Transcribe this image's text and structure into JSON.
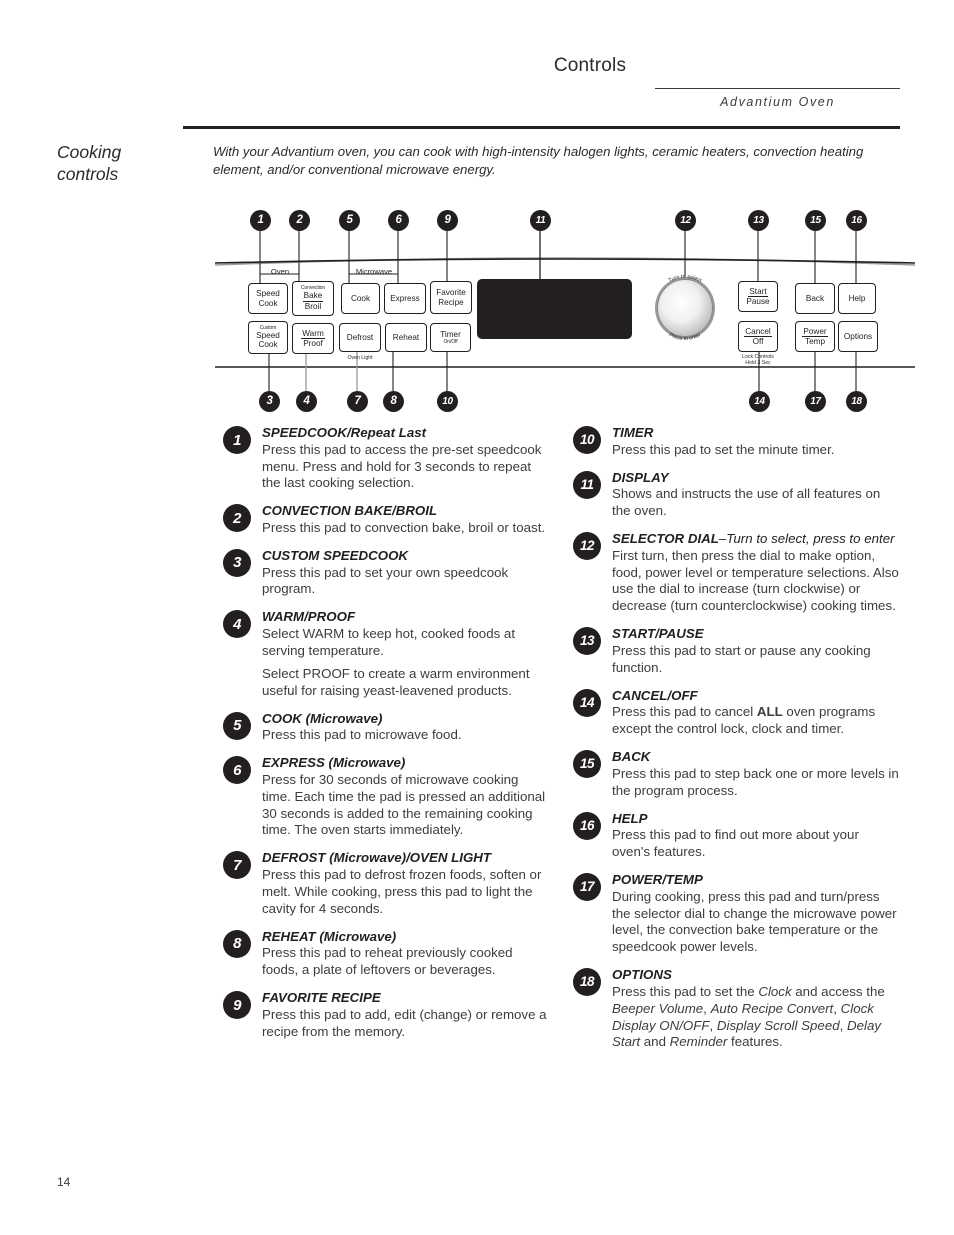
{
  "header": {
    "title": "Controls",
    "subtitle": "Advantium Oven"
  },
  "side_heading": "Cooking\ncontrols",
  "intro": "With your Advantium oven, you can cook with high-intensity halogen lights, ceramic heaters, convection heating element, and/or conventional microwave energy.",
  "page_number": "14",
  "control_panel": {
    "group_labels": {
      "oven": "Oven",
      "microwave": "Microwave"
    },
    "pads": [
      {
        "id": "speed-cook",
        "top": "",
        "lines": [
          "Speed",
          "Cook"
        ]
      },
      {
        "id": "convection-bake-broil",
        "top": "Convection",
        "lines": [
          "Bake",
          "Broil"
        ]
      },
      {
        "id": "custom-speed-cook",
        "top": "Custom",
        "lines": [
          "Speed",
          "Cook"
        ]
      },
      {
        "id": "warm-proof",
        "top": "",
        "lines": [
          "Warm",
          "Proof"
        ]
      },
      {
        "id": "cook",
        "top": "",
        "lines": [
          "Cook"
        ]
      },
      {
        "id": "express",
        "top": "",
        "lines": [
          "Express"
        ]
      },
      {
        "id": "defrost",
        "top": "",
        "lines": [
          "Defrost"
        ]
      },
      {
        "id": "reheat",
        "top": "",
        "lines": [
          "Reheat"
        ]
      },
      {
        "id": "favorite-recipe",
        "top": "",
        "lines": [
          "Favorite",
          "Recipe"
        ]
      },
      {
        "id": "timer-on-off",
        "top": "",
        "lines": [
          "Timer",
          "On/Off"
        ]
      },
      {
        "id": "start-pause",
        "top": "",
        "lines": [
          "Start",
          "Pause"
        ]
      },
      {
        "id": "cancel-off",
        "top": "",
        "lines": [
          "Cancel",
          "Off"
        ]
      },
      {
        "id": "back",
        "top": "",
        "lines": [
          "Back"
        ]
      },
      {
        "id": "help",
        "top": "",
        "lines": [
          "Help"
        ]
      },
      {
        "id": "power-temp",
        "top": "",
        "lines": [
          "Power",
          "Temp"
        ]
      },
      {
        "id": "options",
        "top": "",
        "lines": [
          "Options"
        ]
      }
    ],
    "pad_text": {
      "speed_cook_1": "Speed",
      "speed_cook_2": "Cook",
      "convection": "Convection",
      "bake": "Bake",
      "broil": "Broil",
      "custom": "Custom",
      "custom_speed": "Speed",
      "custom_cook": "Cook",
      "warm": "Warm",
      "proof": "Proof",
      "cook": "Cook",
      "express": "Express",
      "defrost": "Defrost",
      "reheat": "Reheat",
      "favorite": "Favorite",
      "recipe": "Recipe",
      "timer": "Timer",
      "timer_onoff": "On/Off",
      "start": "Start",
      "pause": "Pause",
      "cancel": "Cancel",
      "off": "Off",
      "back": "Back",
      "help": "Help",
      "power": "Power",
      "temp": "Temp",
      "options": "Options"
    },
    "sub_labels": {
      "oven_light": "Oven Light",
      "lock_controls": "Lock Controls",
      "hold_3_sec": "Hold 3 Sec"
    },
    "dial": {
      "turn_to_select": "Turn to select",
      "press_to_enter": "Press to enter"
    },
    "callouts_top": [
      "1",
      "2",
      "5",
      "6",
      "9",
      "11",
      "12",
      "13",
      "15",
      "16"
    ],
    "callouts_bottom": [
      "3",
      "4",
      "7",
      "8",
      "10",
      "14",
      "17",
      "18"
    ]
  },
  "items_left": [
    {
      "num": "1",
      "title": "SPEEDCOOK/Repeat Last",
      "paras": [
        "Press this pad to access the pre-set speedcook menu. Press and hold for 3 seconds to repeat the last cooking selection."
      ]
    },
    {
      "num": "2",
      "title": "CONVECTION BAKE/BROIL",
      "paras": [
        "Press this pad to convection bake, broil or toast."
      ]
    },
    {
      "num": "3",
      "title": "CUSTOM SPEEDCOOK",
      "paras": [
        "Press this pad to set your own speedcook program."
      ]
    },
    {
      "num": "4",
      "title": "WARM/PROOF",
      "paras": [
        "Select WARM to keep hot, cooked foods at serving temperature.",
        "Select PROOF to create a warm environment useful for raising yeast-leavened products."
      ]
    },
    {
      "num": "5",
      "title": "COOK (Microwave)",
      "paras": [
        "Press this pad to microwave food."
      ]
    },
    {
      "num": "6",
      "title": "EXPRESS (Microwave)",
      "paras": [
        "Press for 30 seconds of microwave cooking time. Each time the pad is pressed an additional 30 seconds is added to the remaining cooking time. The oven starts immediately."
      ]
    },
    {
      "num": "7",
      "title": "DEFROST (Microwave)/OVEN LIGHT",
      "paras": [
        "Press this pad to defrost frozen foods, soften or melt. While cooking, press this pad to light the cavity for 4 seconds."
      ]
    },
    {
      "num": "8",
      "title": "REHEAT (Microwave)",
      "paras": [
        "Press this pad to reheat previously cooked foods, a plate of leftovers or beverages."
      ]
    },
    {
      "num": "9",
      "title": "FAVORITE RECIPE",
      "paras": [
        "Press this pad to add, edit (change) or remove a recipe from the memory."
      ]
    }
  ],
  "items_right": [
    {
      "num": "10",
      "title": "TIMER",
      "paras": [
        "Press this pad to set the minute timer."
      ]
    },
    {
      "num": "11",
      "title": "DISPLAY",
      "paras": [
        "Shows and instructs the use of all features on the oven."
      ]
    },
    {
      "num": "12",
      "title": "SELECTOR DIAL",
      "title_suffix": "–Turn to select, press to enter",
      "paras": [
        "First turn, then press the dial to make option, food, power level or temperature selections. Also use the dial to increase (turn clockwise) or decrease (turn counterclockwise) cooking times."
      ]
    },
    {
      "num": "13",
      "title": "START/PAUSE",
      "paras": [
        "Press this pad to start or pause any cooking function."
      ]
    },
    {
      "num": "14",
      "title": "CANCEL/OFF",
      "paras": [
        "Press this pad to cancel ALL oven programs except the control lock, clock and timer."
      ]
    },
    {
      "num": "15",
      "title": "BACK",
      "paras": [
        "Press this pad to step back one or more levels in the program process."
      ]
    },
    {
      "num": "16",
      "title": "HELP",
      "paras": [
        "Press this pad to find out more about your oven's features."
      ]
    },
    {
      "num": "17",
      "title": "POWER/TEMP",
      "paras": [
        "During cooking, press this pad and turn/press the selector dial to change the microwave power level, the convection bake temperature or the speedcook power levels."
      ]
    },
    {
      "num": "18",
      "title": "OPTIONS",
      "paras": [
        "Press this pad to set the Clock and access the Beeper Volume, Auto Recipe Convert, Clock Display ON/OFF, Display Scroll Speed, Delay Start and Reminder features."
      ]
    }
  ]
}
